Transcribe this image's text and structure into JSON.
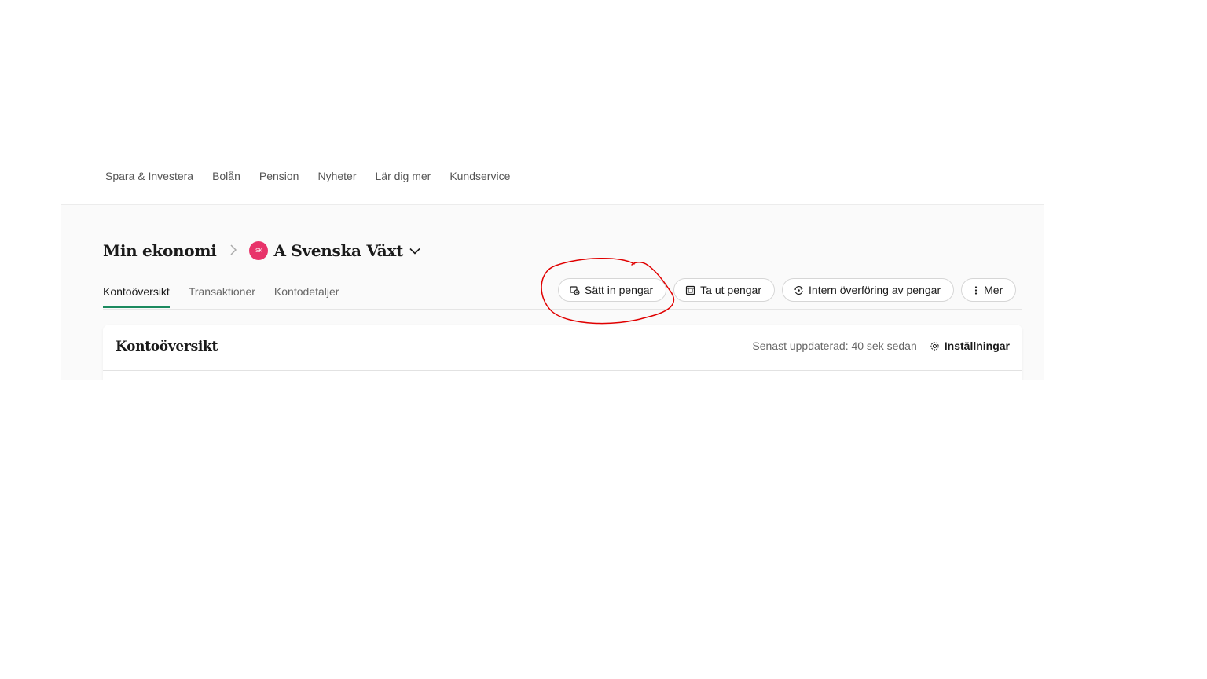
{
  "top_nav": {
    "items": [
      "Spara & Investera",
      "Bolån",
      "Pension",
      "Nyheter",
      "Lär dig mer",
      "Kundservice"
    ]
  },
  "breadcrumb": {
    "root": "Min ekonomi",
    "account_badge": "ISK",
    "account_name": "A Svenska Växt"
  },
  "tabs": [
    {
      "label": "Kontoöversikt",
      "active": true
    },
    {
      "label": "Transaktioner",
      "active": false
    },
    {
      "label": "Kontodetaljer",
      "active": false
    }
  ],
  "actions": {
    "deposit": "Sätt in pengar",
    "withdraw": "Ta ut pengar",
    "internal_transfer": "Intern överföring av pengar",
    "more": "Mer"
  },
  "card": {
    "title": "Kontoöversikt",
    "updated": "Senast uppdaterad: 40 sek sedan",
    "settings": "Inställningar"
  },
  "colors": {
    "accent": "#1c8a5f",
    "isk_badge": "#e8336a",
    "annotation": "#e00000"
  }
}
